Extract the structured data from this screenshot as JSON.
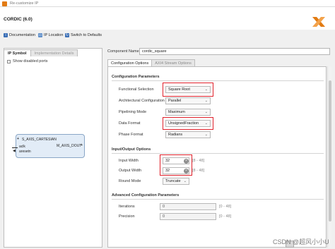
{
  "window": {
    "title": "Re-customize IP"
  },
  "header": {
    "ip_name": "CORDIC (6.0)",
    "toolbar": {
      "documentation": "Documentation",
      "ip_location": "IP Location",
      "switch_defaults": "Switch to Defaults"
    }
  },
  "left_panel": {
    "tabs": [
      {
        "label": "IP Symbol",
        "active": true
      },
      {
        "label": "Implementation Details",
        "active": false
      }
    ],
    "show_disabled_ports": "Show disabled ports",
    "ip_symbol": {
      "ports_left": [
        "S_AXIS_CARTESIAN",
        "aclk",
        "aresetn"
      ],
      "ports_right": [
        "M_AXIS_DOUT"
      ]
    }
  },
  "component_name": {
    "label": "Component Name",
    "value": "cordic_square"
  },
  "config_tabs": [
    {
      "label": "Configuration Options",
      "active": true
    },
    {
      "label": "AXI4 Stream Options",
      "active": false
    }
  ],
  "config_params": {
    "section_title": "Configuration Parameters",
    "rows": [
      {
        "label": "Functional Selection",
        "value": "Square Root"
      },
      {
        "label": "Architectural Configuration",
        "value": "Parallel"
      },
      {
        "label": "Pipelining Mode",
        "value": "Maximum"
      },
      {
        "label": "Data Format",
        "value": "UnsignedFraction"
      },
      {
        "label": "Phase Format",
        "value": "Radians"
      }
    ]
  },
  "io_options": {
    "section_title": "Input/Output Options",
    "input_width": {
      "label": "Input Width",
      "value": "32",
      "range": "[8 - 48]"
    },
    "output_width": {
      "label": "Output Width",
      "value": "32",
      "range": "[8 - 48]"
    },
    "round_mode": {
      "label": "Round Mode",
      "value": "Truncate"
    }
  },
  "advanced": {
    "section_title": "Advanced Configuration Parameters",
    "iterations": {
      "label": "Iterations",
      "value": "0",
      "range": "[0 - 48]"
    },
    "precision": {
      "label": "Precision",
      "value": "0",
      "range": "[0 - 48]"
    }
  },
  "watermark": "CSDN @超风小小U",
  "colors": {
    "highlight": "#e0202a",
    "logo": "#e27b13",
    "block_fill": "#e2ecf7"
  }
}
